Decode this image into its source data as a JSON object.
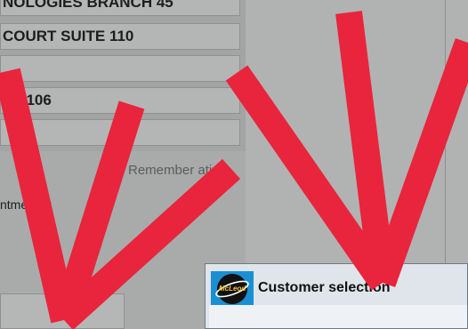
{
  "address": {
    "line1": "NOLOGIES BRANCH 45",
    "line2": "COURT SUITE 110",
    "line3": "",
    "line4": "PA 106",
    "line5": ""
  },
  "remember_label": "Remember ation",
  "appointment_label": "ntme equ",
  "dialog": {
    "title": "Customer selection",
    "logo_text": "McLeod"
  },
  "overlay_colors": {
    "mark": "#e8253c"
  }
}
